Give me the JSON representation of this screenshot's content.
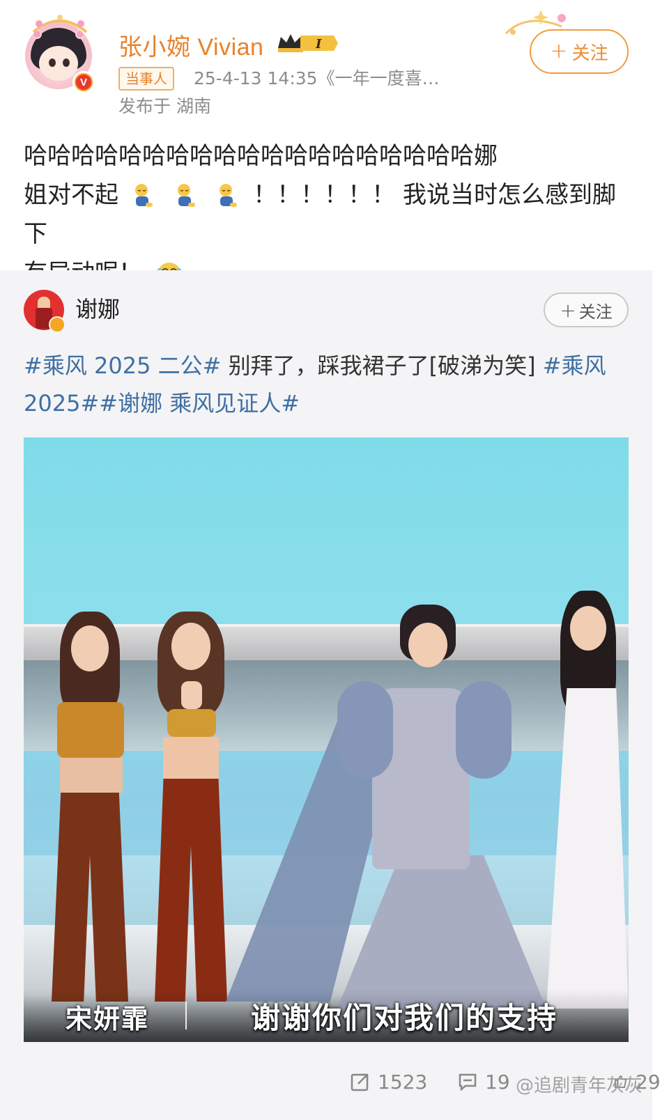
{
  "author": {
    "name": "张小婉 Vivian",
    "level_badge": "I",
    "tag": "当事人",
    "time_source": "25-4-13 14:35《一年一度喜…",
    "location": "发布于 湖南",
    "follow_label": "关注"
  },
  "post": {
    "text_line1": "哈哈哈哈哈哈哈哈哈哈哈哈哈哈哈哈哈哈哈娜",
    "text_line2_a": "姐对不起",
    "text_line2_b": "！！！！！！ 我说当时怎么感到脚下",
    "text_line3": "有异动呢！",
    "emojis": [
      "kneel-emoji",
      "kneel-emoji",
      "kneel-emoji",
      "laugh-cry-emoji"
    ]
  },
  "repost": {
    "author_name": "谢娜",
    "follow_label": "关注",
    "hashtag1": "#乘风 2025 二公#",
    "text_mid": " 别拜了，踩我裙子了[破涕为笑] ",
    "hashtag2": "#乘风 2025##谢娜 乘风见证人#",
    "video": {
      "subtitle_name": "宋妍霏",
      "subtitle_text": "谢谢你们对我们的支持"
    }
  },
  "actions": {
    "repost_count": "1523",
    "comment_count": "19",
    "like_count": "29"
  },
  "watermark": "@追剧青年灰灰",
  "colors": {
    "accent_orange": "#e8822a",
    "hashtag_blue": "#3f6fa3",
    "bg_repost": "#f4f4f6"
  }
}
